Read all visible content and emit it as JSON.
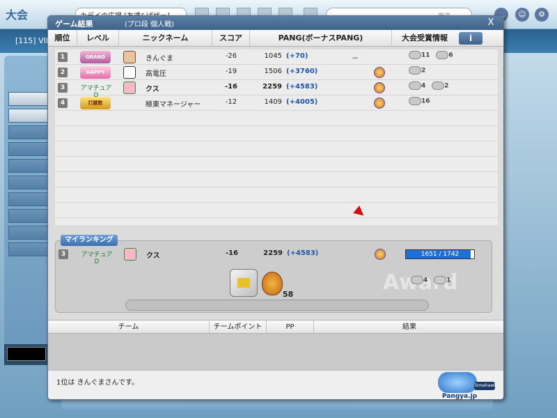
{
  "background": {
    "logo": "大会",
    "room_title": "カデイの広場 [友達&ぱザー]",
    "search_placeholder": "申送",
    "room_number": "[115]  VII"
  },
  "dialog": {
    "title": "ゲーム結果",
    "subtitle": "(プロ段 個人戦)",
    "close": "X",
    "headers": {
      "rank": "順位",
      "level": "レベル",
      "nickname": "ニックネーム",
      "score": "スコア",
      "pang": "PANG(ボーナスPANG)",
      "award": "大会受賞情報",
      "info": "i"
    },
    "players": [
      {
        "rank": "1",
        "level": "GRAND ZODIAC",
        "nick": "きんぐま",
        "score": "-26",
        "pang": "1045",
        "bonus": "(+70)",
        "special": "－",
        "awards": [
          "11",
          "6"
        ]
      },
      {
        "rank": "2",
        "level": "HAPPY BIRTHDAY",
        "nick": "高電圧",
        "score": "-19",
        "pang": "1506",
        "bonus": "(+3760)",
        "awards": [
          "2"
        ]
      },
      {
        "rank": "3",
        "level": "アマチュアD",
        "nick": "クス",
        "score": "-16",
        "pang": "2259",
        "bonus": "(+4583)",
        "awards": [
          "4",
          "2"
        ]
      },
      {
        "rank": "4",
        "level": "打鍵数",
        "nick": "極東マネージャー",
        "score": "-12",
        "pang": "1409",
        "bonus": "(+4005)",
        "awards": [
          "16"
        ]
      }
    ],
    "my_ranking": {
      "label": "マイランキング",
      "rank": "3",
      "level": "アマチュアD",
      "nick": "クス",
      "score": "-16",
      "pang": "2259",
      "bonus": "(+4583)",
      "exp_text": "1651 / 1742",
      "exp_fraction": 0.948,
      "award_watermark": "Award",
      "pang_item_count": "58",
      "awards": [
        "4",
        "1"
      ]
    },
    "team_headers": {
      "team": "チーム",
      "team_point": "チームポイント",
      "pp": "PP",
      "result": "結果"
    },
    "footer_message": "1位は きんぐまさんです。",
    "logo": {
      "text": "Pangya.jp",
      "badge": "Tomahawk"
    }
  }
}
